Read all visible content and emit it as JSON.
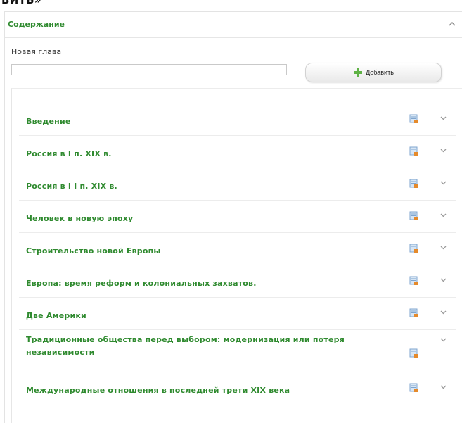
{
  "header": {
    "cut_text": "ВИТЬ»"
  },
  "panel": {
    "title": "Содержание",
    "new_chapter_label": "Новая глава",
    "new_chapter_value": "",
    "add_button_label": "Добавить"
  },
  "chapters": [
    {
      "label": "Введение"
    },
    {
      "label": "Россия в I п. XIX в."
    },
    {
      "label": "Россия в I I п. XIX в."
    },
    {
      "label": "Человек в новую эпоху"
    },
    {
      "label": "Строительство новой Европы"
    },
    {
      "label": "Европа: время реформ и колониальных захватов."
    },
    {
      "label": "Две Америки"
    },
    {
      "label": "Традиционные общества перед выбором: модернизация или потеря независимости"
    },
    {
      "label": "Международные отношения в последней трети XIX века"
    }
  ],
  "colors": {
    "accent_green": "#2f8a2f",
    "plus_green": "#5fb245",
    "doc_blue": "#7fa5cf",
    "doc_orange": "#e58a2b"
  },
  "icons": {
    "collapse": "chevron-up-icon",
    "add": "plus-icon",
    "doc": "document-edit-icon",
    "expand": "chevron-down-icon"
  }
}
